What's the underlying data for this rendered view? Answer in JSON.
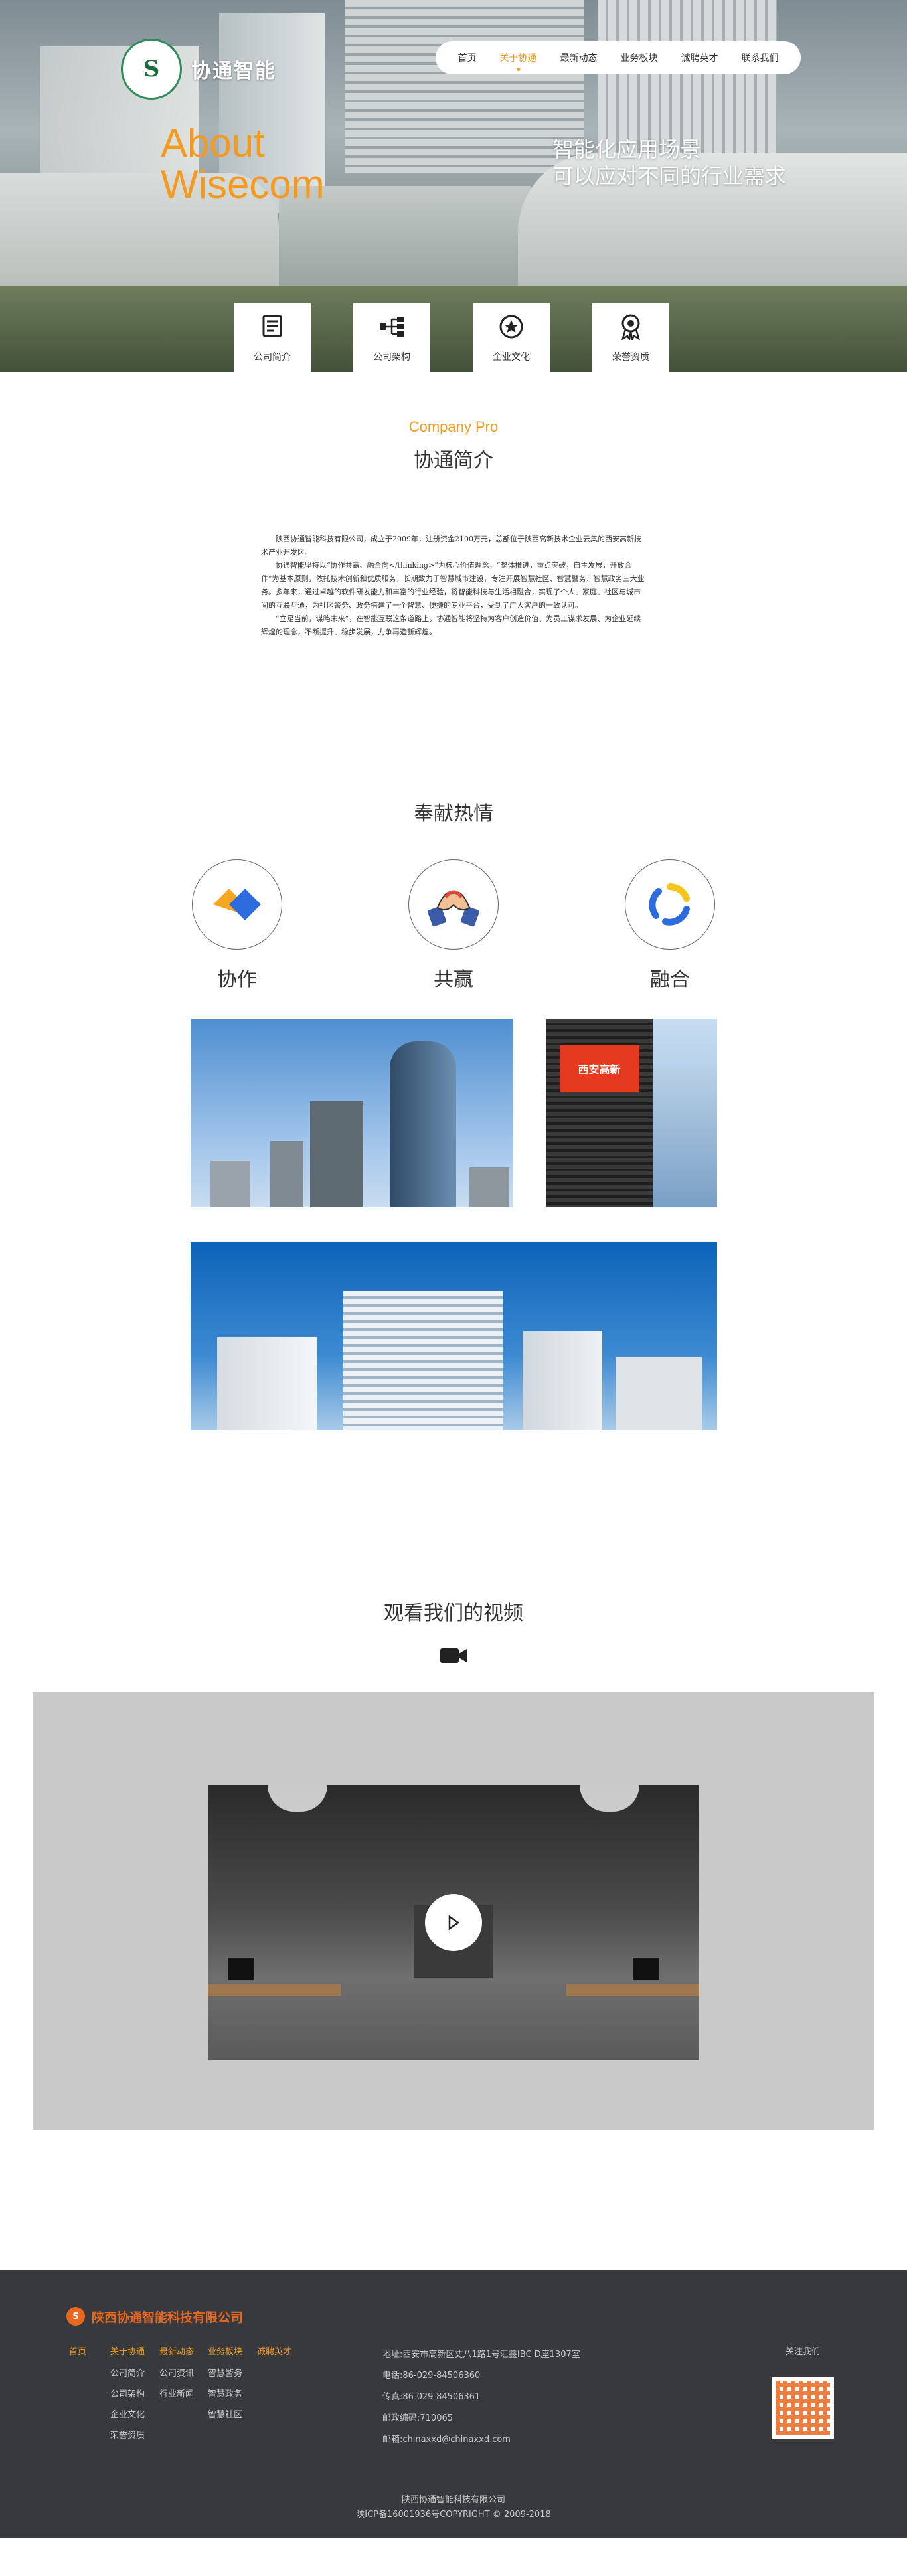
{
  "header": {
    "logo_text": "协通智能",
    "logo_mark": "S"
  },
  "nav": {
    "items": [
      {
        "label": "首页"
      },
      {
        "label": "关于协通",
        "active": true
      },
      {
        "label": "最新动态"
      },
      {
        "label": "业务板块"
      },
      {
        "label": "诚聘英才"
      },
      {
        "label": "联系我们"
      }
    ]
  },
  "hero": {
    "about_line1": "About",
    "about_line2": "Wisecom",
    "slogan_line1": "智能化应用场景",
    "slogan_line2": "可以应对不同的行业需求"
  },
  "tabs": [
    {
      "label": "公司简介",
      "icon": "document-icon",
      "active": true
    },
    {
      "label": "公司架构",
      "icon": "hierarchy-icon"
    },
    {
      "label": "企业文化",
      "icon": "star-badge-icon"
    },
    {
      "label": "荣誉资质",
      "icon": "medal-icon"
    }
  ],
  "profile": {
    "title_en": "Company Pro",
    "title_cn": "协通简介",
    "paragraphs": [
      "陕西协通智能科技有限公司，成立于2009年，注册资金2100万元，总部位于陕西高新技术企业云集的西安高新技术产业开发区。",
      "协通智能坚持以“协作共赢、融合向</thinking>”为核心价值理念，“整体推进，重点突破，自主发展，开放合作”为基本原则，依托技术创新和优质服务，长期致力于智慧城市建设，专注开展智慧社区、智慧警务、智慧政务三大业务。多年来，通过卓越的软件研发能力和丰富的行业经验，将智能科技与生活相融合，实现了个人、家庭、社区与城市间的互联互通，为社区警务、政务搭建了一个智慧、便捷的专业平台，受到了广大客户的一致认可。",
      "“立足当前，谋略未来”，在智能互联这条道路上，协通智能将坚持为客户创造价值、为员工谋求发展、为企业延续辉煌的理念，不断提升、稳步发展，力争再造新辉煌。"
    ]
  },
  "dedication": {
    "title": "奉献热情",
    "values": [
      {
        "label": "协作",
        "icon": "cooperation-icon"
      },
      {
        "label": "共赢",
        "icon": "handshake-icon"
      },
      {
        "label": "融合",
        "icon": "fusion-icon"
      }
    ],
    "sign_text": "西安高新"
  },
  "video": {
    "title": "观看我们的视频",
    "icon": "video-camera-icon"
  },
  "footer": {
    "logo_text": "陕西协通智能科技有限公司",
    "columns": [
      {
        "head": "首页",
        "links": []
      },
      {
        "head": "关于协通",
        "links": [
          "公司简介",
          "公司架构",
          "企业文化",
          "荣誉资质"
        ]
      },
      {
        "head": "最新动态",
        "links": [
          "公司资讯",
          "行业新闻"
        ]
      },
      {
        "head": "业务板块",
        "links": [
          "智慧警务",
          "智慧政务",
          "智慧社区"
        ]
      },
      {
        "head": "诚聘英才",
        "links": []
      }
    ],
    "contact": {
      "address": "地址:西安市高新区丈八1路1号汇鑫IBC D座1307室",
      "phone": "电话:86-029-84506360",
      "fax": "传真:86-029-84506361",
      "postcode": "邮政编码:710065",
      "email": "邮箱:chinaxxd@chinaxxd.com"
    },
    "follow": "关注我们",
    "company": "陕西协通智能科技有限公司",
    "copyright": "陕ICP备16001936号COPYRIGHT © 2009-2018"
  }
}
